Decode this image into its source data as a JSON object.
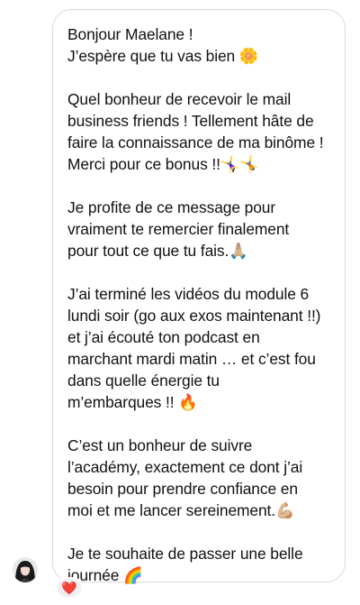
{
  "message": {
    "paragraphs": [
      "Bonjour Maelane !\nJ’espère que tu vas bien 🌼",
      "Quel bonheur de recevoir le mail\nbusiness friends ! Tellement hâte de\nfaire la connaissance de ma binôme !\nMerci pour ce bonus !!🤸‍♀️🤸",
      "Je profite de ce message pour\nvraiment te remercier finalement\npour tout ce que tu fais.🙏🏼",
      "J’ai terminé les vidéos du module 6\nlundi soir (go aux exos maintenant !!)\net j’ai écouté ton podcast en\nmarchant mardi matin … et c’est fou\ndans quelle énergie tu\nm’embarques !! 🔥",
      "C’est un bonheur de suivre\nl’académy, exactement ce dont j’ai\nbesoin pour prendre confiance en\nmoi et me lancer sereinement.💪🏼",
      "Je te souhaite de passer une belle\njournée 🌈"
    ]
  },
  "reaction": {
    "emoji": "❤️"
  },
  "avatar": {
    "icon": "avatar-icon"
  }
}
